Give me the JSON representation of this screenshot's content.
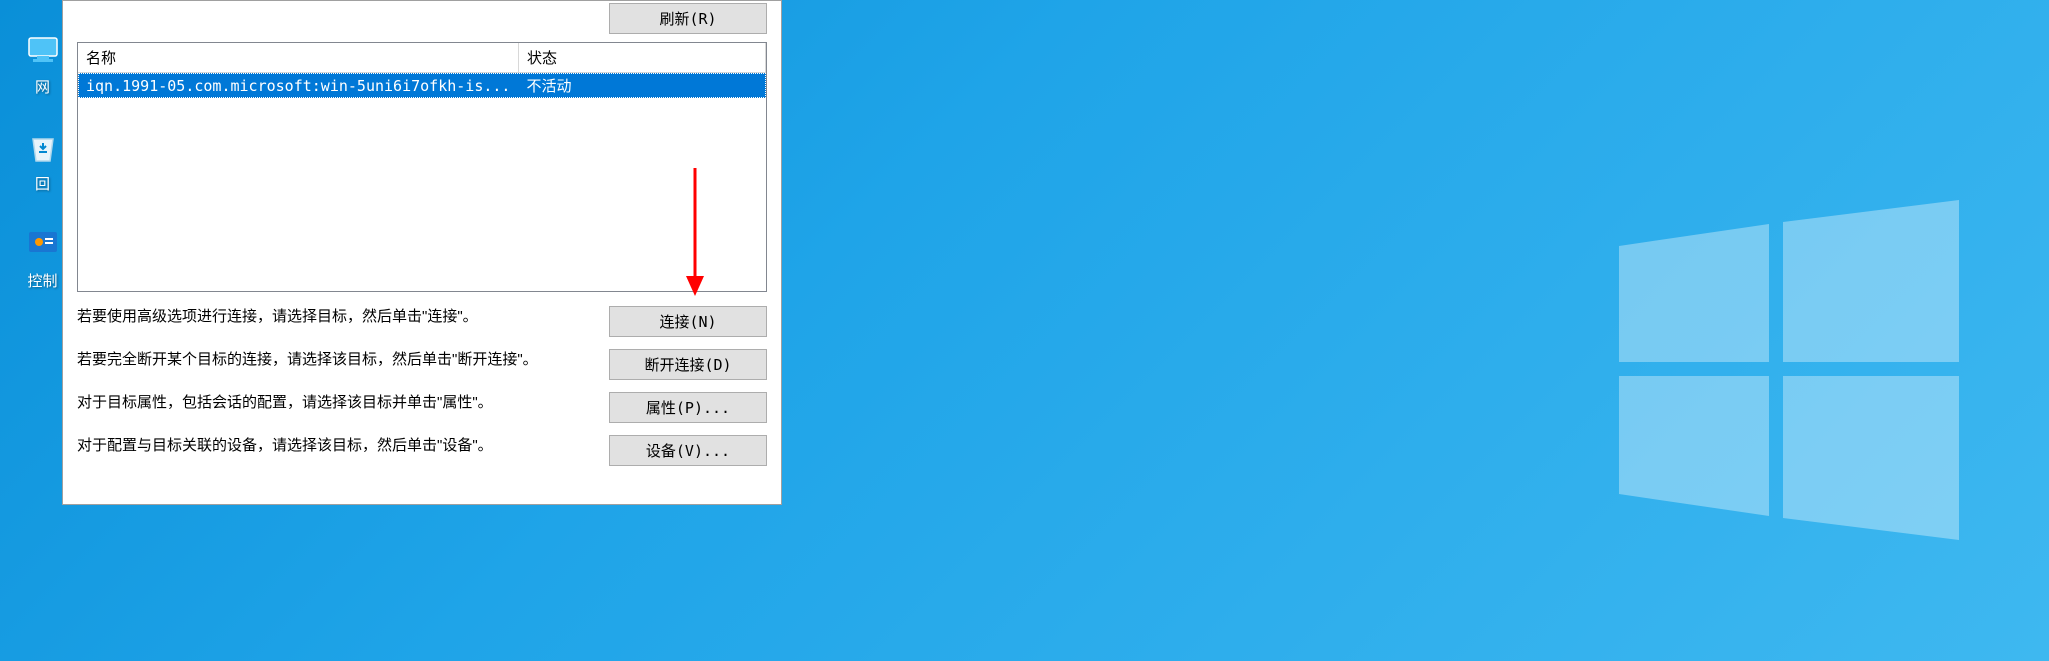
{
  "desktop": {
    "icons": [
      {
        "name": "network-icon",
        "label": "网"
      },
      {
        "name": "recycle-bin-icon",
        "label": "回"
      },
      {
        "name": "control-panel-icon",
        "label": "控制"
      }
    ]
  },
  "dialog": {
    "refresh_button": "刷新(R)",
    "table": {
      "headers": {
        "name": "名称",
        "status": "状态"
      },
      "rows": [
        {
          "name": "iqn.1991-05.com.microsoft:win-5uni6i7ofkh-is...",
          "status": "不活动",
          "selected": true
        }
      ]
    },
    "actions": {
      "connect": {
        "desc": "若要使用高级选项进行连接，请选择目标，然后单击\"连接\"。",
        "button": "连接(N)"
      },
      "disconnect": {
        "desc": "若要完全断开某个目标的连接，请选择该目标，然后单击\"断开连接\"。",
        "button": "断开连接(D)"
      },
      "properties": {
        "desc": "对于目标属性，包括会话的配置，请选择该目标并单击\"属性\"。",
        "button": "属性(P)..."
      },
      "devices": {
        "desc": "对于配置与目标关联的设备，请选择该目标，然后单击\"设备\"。",
        "button": "设备(V)..."
      }
    }
  }
}
